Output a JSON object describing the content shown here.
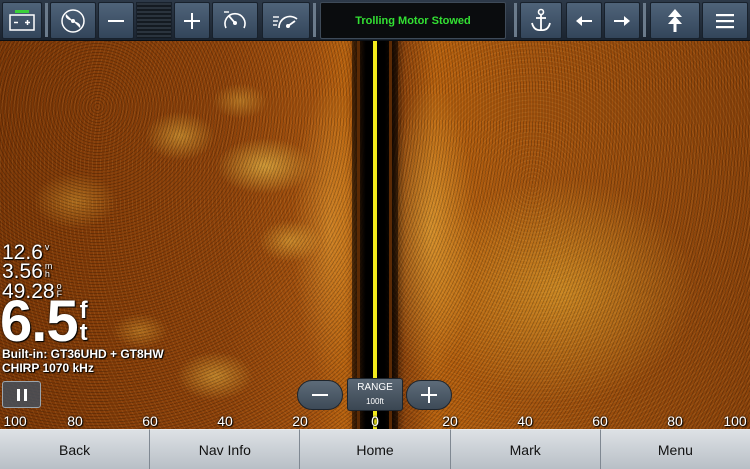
{
  "toolbar": {
    "status_text": "Trolling Motor Stowed",
    "buttons": [
      {
        "name": "battery-icon"
      },
      {
        "name": "propeller-icon"
      },
      {
        "name": "minus-icon"
      },
      {
        "name": "plus-icon"
      },
      {
        "name": "speed-gauge-icon"
      },
      {
        "name": "cruise-control-icon"
      },
      {
        "name": "anchor-icon"
      },
      {
        "name": "arrow-left-icon"
      },
      {
        "name": "arrow-right-icon"
      },
      {
        "name": "stow-icon"
      },
      {
        "name": "menu-icon"
      }
    ]
  },
  "readouts": {
    "voltage": {
      "value": "12.6",
      "unit": "v"
    },
    "speed": {
      "value": "3.56",
      "unit_top": "m",
      "unit_bottom": "h"
    },
    "temperature": {
      "value": "49.28",
      "unit_top": "o",
      "unit_bottom": "F"
    },
    "depth": {
      "value": "6.5",
      "unit_top": "f",
      "unit_bottom": "t"
    },
    "transducer_line1": "Built-in: GT36UHD + GT8HW",
    "transducer_line2": "CHIRP 1070 kHz"
  },
  "range": {
    "label": "RANGE",
    "value": "100ft"
  },
  "scale": [
    "100",
    "80",
    "60",
    "40",
    "20",
    "0",
    "20",
    "40",
    "60",
    "80",
    "100"
  ],
  "softkeys": [
    "Back",
    "Nav Info",
    "Home",
    "Mark",
    "Menu"
  ],
  "colors": {
    "status_text": "#33e033",
    "center_line": "#f2ea1c",
    "sonar_base": "#8e420a"
  }
}
